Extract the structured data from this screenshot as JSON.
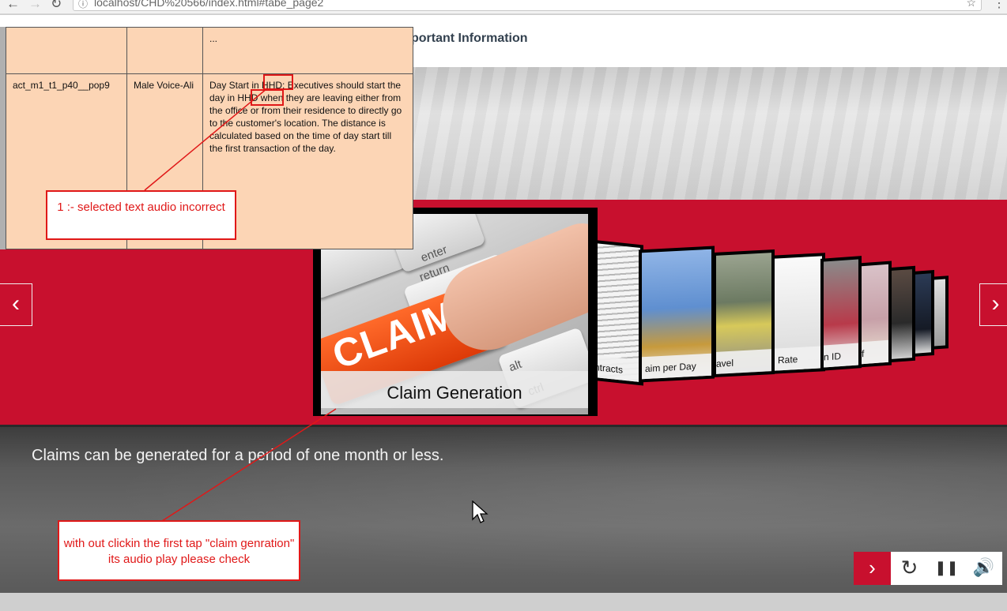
{
  "browser": {
    "url": "localhost/CHD%20566/index.html#tabe_page2",
    "back_icon": "←",
    "forward_icon": "→",
    "reload_icon": "↻",
    "info_icon": "ⓘ",
    "star_icon": "☆",
    "menu_icon": "⋮"
  },
  "header": {
    "title_fragment": "portant Information"
  },
  "carousel": {
    "main_label": "Claim Generation",
    "main_image_text": "CLAIM",
    "key_labels": [
      "enter",
      "return",
      "alt",
      "ctrl"
    ],
    "side_labels": [
      "ntracts",
      "aim per Day",
      "avel",
      "Rate",
      "n ID",
      "f"
    ],
    "prev_icon": "‹",
    "next_icon": "›"
  },
  "caption": "Claims can be generated for a period of one month or less.",
  "controls": {
    "next_icon": "›",
    "replay_icon": "↻",
    "pause_icon": "❚❚",
    "volume_icon": "🔊"
  },
  "review_table": {
    "top_row_fragment": "...",
    "row": {
      "id": "act_m1_t1_p40__pop9",
      "voice": "Male Voice-Ali",
      "text": "Day Start in HHD: Executives should start the day in HHD when they are leaving either from the office or from their residence to directly go to the customer's location. The distance is calculated based on the time of day start till the first transaction of the day."
    }
  },
  "annotations": {
    "note1": "1 :- selected text audio incorrect",
    "note2": "with out clickin the first tap \"claim genration\" its audio play please check"
  },
  "colors": {
    "brand_red": "#c8102e",
    "annotation_red": "#e01818",
    "table_peach": "#fcd5b5"
  }
}
